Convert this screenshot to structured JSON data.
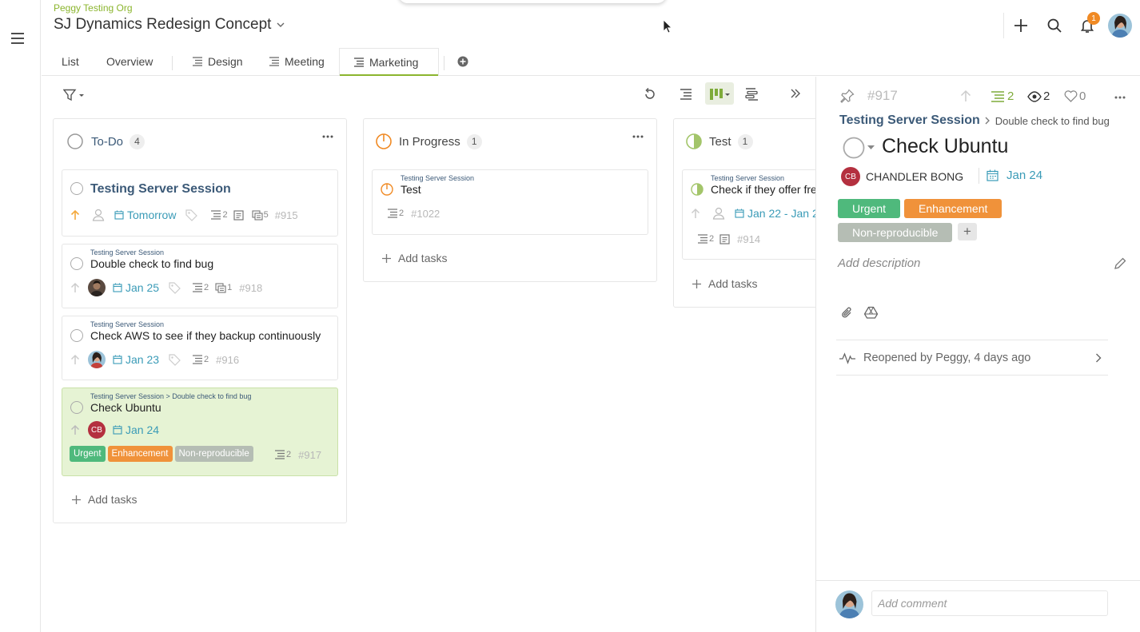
{
  "header": {
    "org": "Peggy Testing Org",
    "project_title": "SJ Dynamics Redesign Concept",
    "notification_count": "1"
  },
  "tabs": [
    {
      "label": "List"
    },
    {
      "label": "Overview"
    },
    {
      "label": "Design"
    },
    {
      "label": "Meeting"
    },
    {
      "label": "Marketing"
    }
  ],
  "columns": {
    "todo": {
      "title": "To-Do",
      "count": "4",
      "add_label": "Add tasks"
    },
    "inprogress": {
      "title": "In Progress",
      "count": "1",
      "add_label": "Add tasks"
    },
    "test": {
      "title": "Test",
      "count": "1",
      "add_label": "Add tasks"
    }
  },
  "cards": {
    "c915": {
      "title": "Testing Server Session",
      "date": "Tomorrow",
      "subtasks": "2",
      "checklist": "5",
      "id": "#915"
    },
    "c918": {
      "parent": "Testing Server Session",
      "title": "Double check to find bug",
      "date": "Jan 25",
      "subtasks": "2",
      "checklist": "1",
      "id": "#918"
    },
    "c916": {
      "parent": "Testing Server Session",
      "title": "Check AWS to see if they backup continuously",
      "date": "Jan 23",
      "subtasks": "2",
      "id": "#916"
    },
    "c917": {
      "parent": "Testing Server Session > Double check to find bug",
      "title": "Check Ubuntu",
      "avatar": "CB",
      "date": "Jan 24",
      "subtasks": "2",
      "id": "#917",
      "tags": [
        {
          "label": "Urgent",
          "color": "#4fb97c"
        },
        {
          "label": "Enhancement",
          "color": "#f0923a"
        },
        {
          "label": "Non-reproducible",
          "color": "#b5bdb4"
        }
      ]
    },
    "c1022": {
      "parent": "Testing Server Session",
      "title": "Test",
      "subtasks": "2",
      "id": "#1022"
    },
    "c914": {
      "parent": "Testing Server Session",
      "title": "Check if they offer free",
      "date": "Jan 22 - Jan 2",
      "subtasks": "2",
      "id": "#914"
    }
  },
  "detail": {
    "id": "#917",
    "subtasks": "2",
    "watchers": "2",
    "likes": "0",
    "breadcrumb_parent": "Testing Server Session",
    "breadcrumb_child": "Double check to find bug",
    "title": "Check Ubuntu",
    "assignee_initials": "CB",
    "assignee_name": "CHANDLER BONG",
    "date": "Jan 24",
    "tags": [
      {
        "label": "Urgent",
        "color": "#4fb97c"
      },
      {
        "label": "Enhancement",
        "color": "#f0923a"
      },
      {
        "label": "Non-reproducible",
        "color": "#b5bdb4"
      }
    ],
    "add_tag": "+",
    "description_placeholder": "Add description",
    "activity": "Reopened by Peggy, 4 days ago",
    "comment_placeholder": "Add comment"
  },
  "colors": {
    "accent_green": "#8bb52e",
    "date_blue": "#3a9bb7",
    "title_blue": "#3c5a78",
    "selected_card": "#e6f3d4",
    "in_progress_orange": "#f08a24",
    "avatar_red": "#b4303f"
  },
  "icons": [
    "hamburger-icon",
    "chevron-down-icon",
    "plus-icon",
    "search-icon",
    "bell-icon",
    "filter-icon",
    "refresh-icon",
    "list-view-icon",
    "board-view-icon",
    "gantt-view-icon",
    "collapse-panel-icon",
    "more-icon",
    "priority-arrow-icon",
    "user-icon",
    "calendar-icon",
    "tag-icon",
    "subtask-icon",
    "note-icon",
    "checklist-icon",
    "pin-icon",
    "eye-icon",
    "heart-icon",
    "pencil-icon",
    "paperclip-icon",
    "google-drive-icon",
    "activity-icon",
    "chevron-right-icon"
  ]
}
